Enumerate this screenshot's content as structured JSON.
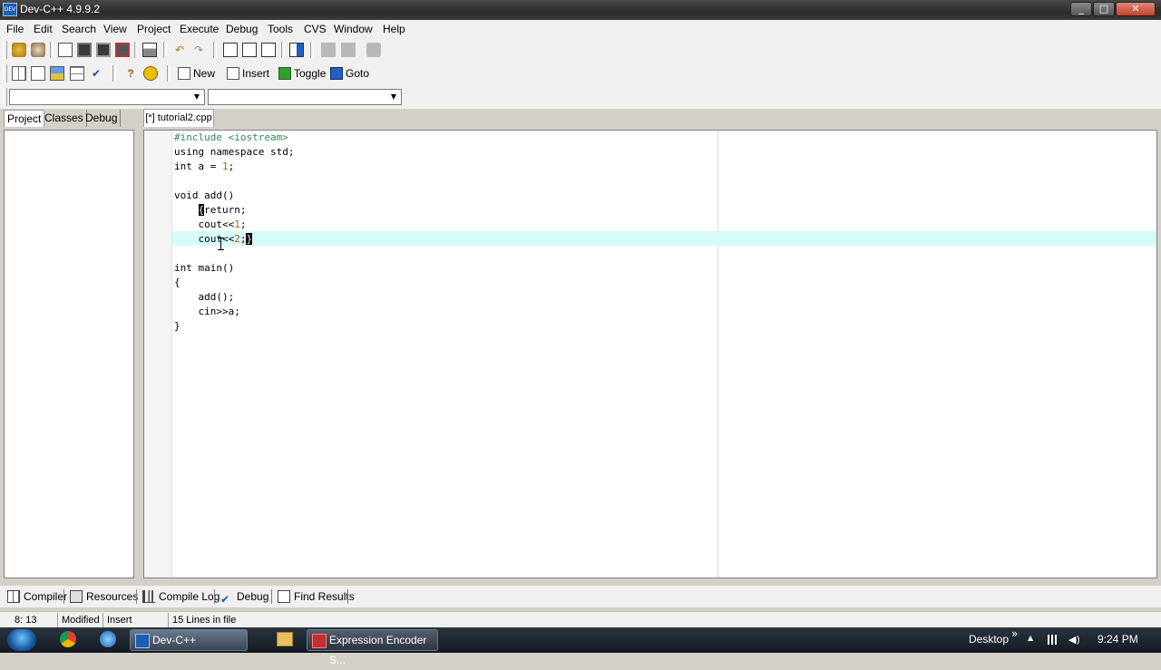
{
  "window": {
    "title": "Dev-C++ 4.9.9.2",
    "app_icon_text": "DEV",
    "min": "_",
    "max": "□",
    "close": "✕"
  },
  "menu": [
    "File",
    "Edit",
    "Search",
    "View",
    "Project",
    "Execute",
    "Debug",
    "Tools",
    "CVS",
    "Window",
    "Help"
  ],
  "toolbar2": {
    "new_label": "New",
    "insert_label": "Insert",
    "toggle_label": "Toggle",
    "goto_label": "Goto"
  },
  "left_tabs": [
    "Project",
    "Classes",
    "Debug"
  ],
  "editor": {
    "tab_label": "[*] tutorial2.cpp",
    "lines": [
      "#include <iostream>",
      "using namespace std;",
      "int a = 1;",
      "",
      "void add()",
      "    {return;",
      "    cout<<1;",
      "    cout<<2;}",
      "",
      "int main()",
      "{",
      "    add();",
      "    cin>>a;",
      "}"
    ]
  },
  "bottom_tabs": [
    "Compiler",
    "Resources",
    "Compile Log",
    "Debug",
    "Find Results"
  ],
  "status": {
    "position": "8: 13",
    "modified": "Modified",
    "mode": "Insert",
    "lines_info": "15 Lines in file"
  },
  "taskbar": {
    "apps": [
      "Dev-C++",
      "Expression Encoder S..."
    ],
    "desktop_label": "Desktop",
    "chevron": "»",
    "tray_up": "▲",
    "clock": "9:24 PM"
  },
  "colors": {
    "highlight_line": "#d6fbfb",
    "preprocessor": "#2e8b57",
    "number": "#c06000"
  }
}
